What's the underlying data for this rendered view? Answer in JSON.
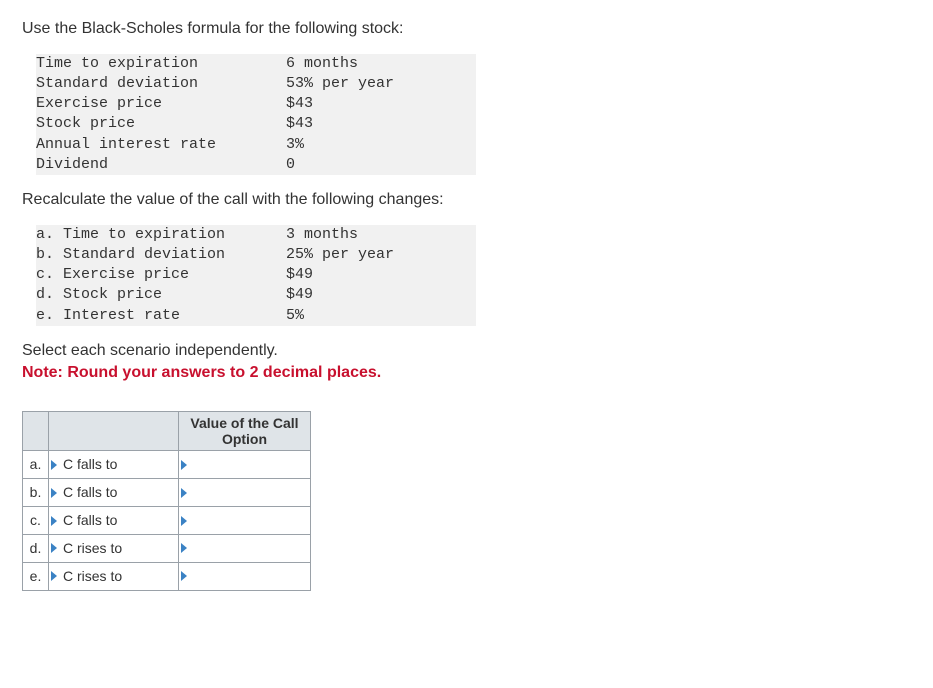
{
  "intro": "Use the Black-Scholes formula for the following stock:",
  "base_params": [
    {
      "label": "Time to expiration",
      "value": "6 months"
    },
    {
      "label": "Standard deviation",
      "value": "53% per year"
    },
    {
      "label": "Exercise price",
      "value": "$43"
    },
    {
      "label": "Stock price",
      "value": "$43"
    },
    {
      "label": "Annual interest rate",
      "value": "3%"
    },
    {
      "label": "Dividend",
      "value": "0"
    }
  ],
  "recalc_text": "Recalculate the value of the call with the following changes:",
  "change_params": [
    {
      "label": "a. Time to expiration",
      "value": "3 months"
    },
    {
      "label": "b. Standard deviation",
      "value": "25% per year"
    },
    {
      "label": "c. Exercise price",
      "value": "$49"
    },
    {
      "label": "d. Stock price",
      "value": "$49"
    },
    {
      "label": "e. Interest rate",
      "value": "5%"
    }
  ],
  "instruction_line1": "Select each scenario independently.",
  "instruction_line2": "Note: Round your answers to 2 decimal places.",
  "answer_header": "Value of the Call Option",
  "answer_rows": [
    {
      "letter": "a.",
      "desc": "C falls to",
      "value": ""
    },
    {
      "letter": "b.",
      "desc": "C falls to",
      "value": ""
    },
    {
      "letter": "c.",
      "desc": "C falls to",
      "value": ""
    },
    {
      "letter": "d.",
      "desc": "C rises to",
      "value": ""
    },
    {
      "letter": "e.",
      "desc": "C rises to",
      "value": ""
    }
  ]
}
